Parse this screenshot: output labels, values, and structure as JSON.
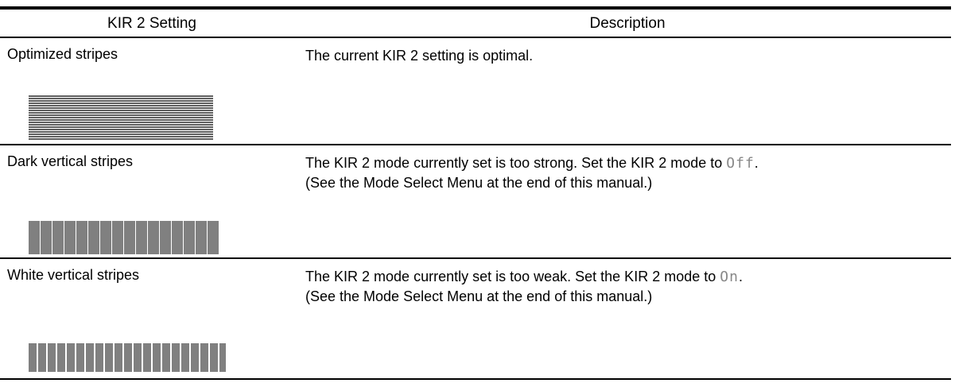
{
  "table": {
    "headers": {
      "setting": "KIR 2 Setting",
      "description": "Description"
    },
    "rows": [
      {
        "setting": "Optimized stripes",
        "description_line1": "The current KIR 2 setting is optimal.",
        "stripe_pattern": "optimized"
      },
      {
        "setting": "Dark vertical stripes",
        "description_line1_before": "The KIR 2 mode currently set is too strong. Set the KIR 2 mode to",
        "lcd_value": "Off",
        "description_line1_after": ".",
        "description_line2": "(See the Mode Select Menu at the end of this manual.)",
        "stripe_pattern": "dark-vertical"
      },
      {
        "setting": "White vertical stripes",
        "description_line1_before": "The KIR 2 mode currently set is too weak. Set the KIR 2 mode to",
        "lcd_value": "On",
        "description_line1_after": ".",
        "description_line2": "(See the Mode Select Menu at the end of this manual.)",
        "stripe_pattern": "white-vertical"
      }
    ]
  },
  "colors": {
    "text": "#000000",
    "rule": "#000000",
    "lcd_glyph": "#888888"
  }
}
